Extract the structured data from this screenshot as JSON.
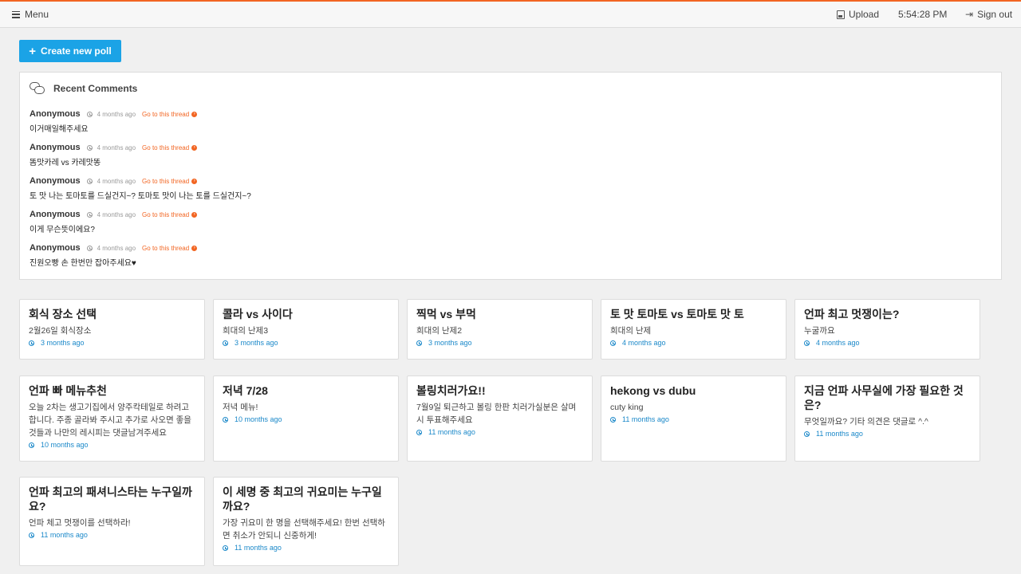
{
  "topbar": {
    "menu_label": "Menu",
    "upload_label": "Upload",
    "time": "5:54:28 PM",
    "signout_label": "Sign out",
    "accent_color": "#f26522"
  },
  "create_button": {
    "label": "Create new poll",
    "color": "#1ba3e6"
  },
  "recent_comments": {
    "title": "Recent Comments",
    "goto_label": "Go to this thread",
    "items": [
      {
        "author": "Anonymous",
        "time": "4 months ago",
        "text": "이거매일해주세요"
      },
      {
        "author": "Anonymous",
        "time": "4 months ago",
        "text": "똠맛카레 vs 카레맛똥"
      },
      {
        "author": "Anonymous",
        "time": "4 months ago",
        "text": "토 맛 나는 토마토를 드실건지~? 토마토 맛이 나는 토를 드실건지~?"
      },
      {
        "author": "Anonymous",
        "time": "4 months ago",
        "text": "이게 무슨뜻이에요?"
      },
      {
        "author": "Anonymous",
        "time": "4 months ago",
        "text": "진원오빵 손 한번만 잡아주세요♥"
      }
    ]
  },
  "polls": [
    {
      "title": "회식 장소 선택",
      "desc": "2월26일 회식장소",
      "time": "3 months ago"
    },
    {
      "title": "콜라 vs 사이다",
      "desc": "희대의 난제3",
      "time": "3 months ago"
    },
    {
      "title": "찍먹 vs 부먹",
      "desc": "희대의 난제2",
      "time": "3 months ago"
    },
    {
      "title": "토 맛 토마토 vs 토마토 맛 토",
      "desc": "희대의 난제",
      "time": "4 months ago"
    },
    {
      "title": "언파 최고 멋쟁이는?",
      "desc": "누굴까요",
      "time": "4 months ago"
    },
    {
      "title": "언파 빠 메뉴추천",
      "desc": "오늘 2차는 생고기집에서 양주칵테일로 하려고 합니다. 주종 골라봐 주시고 추가로 사오면 좋을 것들과 나만의 레시피는 댓글남겨주세요",
      "time": "10 months ago"
    },
    {
      "title": "저녁 7/28",
      "desc": "저녁 메뉴!",
      "time": "10 months ago"
    },
    {
      "title": "볼링치러가요!!",
      "desc": "7월9일 퇴근하고 볼링 한판 치러가실분은 살며시 투표해주세요",
      "time": "11 months ago"
    },
    {
      "title": "hekong vs dubu",
      "desc": "cuty king",
      "time": "11 months ago"
    },
    {
      "title": "지금 언파 사무실에 가장 필요한 것은?",
      "desc": "무엇일까요? 기타 의견은 댓글로 ^.^",
      "time": "11 months ago"
    },
    {
      "title": "언파 최고의 패셔니스타는 누구일까요?",
      "desc": "언파 체고 멋쟁이를 선택하라!",
      "time": "11 months ago"
    },
    {
      "title": "이 세명 중 최고의 귀요미는 누구일까요?",
      "desc": "가장 귀요미 한 명을 선택해주세요! 한번 선택하면 취소가 안되니 신중하게!",
      "time": "11 months ago"
    }
  ]
}
